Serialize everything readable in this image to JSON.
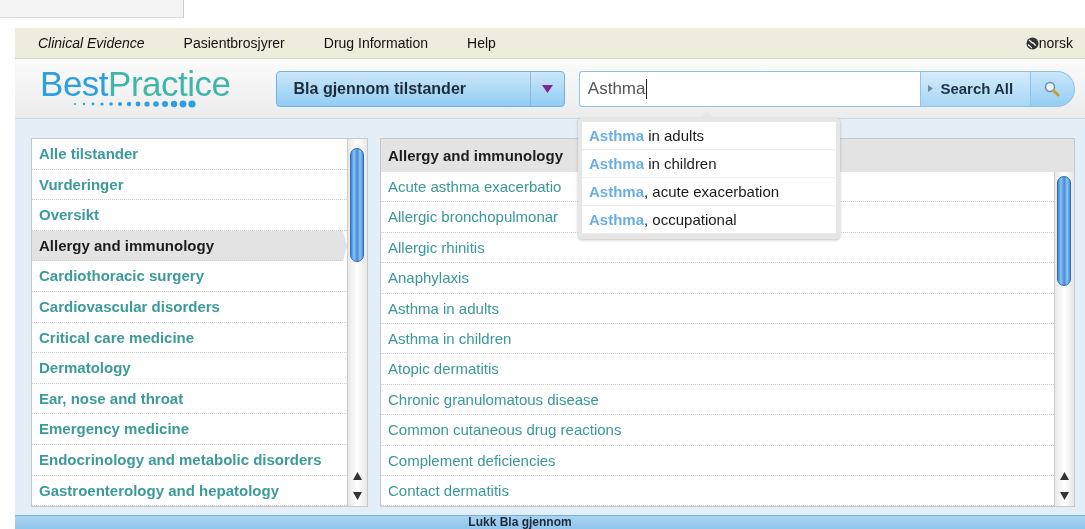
{
  "nav": {
    "links": [
      {
        "label": "Clinical Evidence",
        "italic": true
      },
      {
        "label": "Pasientbrosjyrer",
        "italic": false
      },
      {
        "label": "Drug Information",
        "italic": false
      },
      {
        "label": "Help",
        "italic": false
      }
    ],
    "language": "norsk"
  },
  "logo": {
    "part_1": "Best",
    "part_2": "Practice"
  },
  "browse_dropdown": {
    "label": "Bla gjennom tilstander"
  },
  "search": {
    "value": "Asthma",
    "button": "Search All"
  },
  "suggestions": [
    "**Asthma** in adults",
    "**Asthma** in children",
    "**Asthma**, acute exacerbation",
    "**Asthma**, occupational"
  ],
  "categories": [
    {
      "label": "Alle tilstander",
      "selected": false
    },
    {
      "label": "Vurderinger",
      "selected": false
    },
    {
      "label": "Oversikt",
      "selected": false
    },
    {
      "label": "Allergy and immunology",
      "selected": true
    },
    {
      "label": "Cardiothoracic surgery",
      "selected": false
    },
    {
      "label": "Cardiovascular disorders",
      "selected": false
    },
    {
      "label": "Critical care medicine",
      "selected": false
    },
    {
      "label": "Dermatology",
      "selected": false
    },
    {
      "label": "Ear, nose and throat",
      "selected": false
    },
    {
      "label": "Emergency medicine",
      "selected": false
    },
    {
      "label": "Endocrinology and metabolic disorders",
      "selected": false
    },
    {
      "label": "Gastroenterology and hepatology",
      "selected": false
    }
  ],
  "topics": {
    "heading": "Allergy and immunology",
    "items": [
      "Acute asthma exacerbatio",
      "Allergic bronchopulmonar",
      "Allergic rhinitis",
      "Anaphylaxis",
      "Asthma in adults",
      "Asthma in children",
      "Atopic dermatitis",
      "Chronic granulomatous disease",
      "Common cutaneous drug reactions",
      "Complement deficiencies",
      "Contact dermatitis"
    ]
  },
  "close_bar": "Lukk Bla gjennom"
}
